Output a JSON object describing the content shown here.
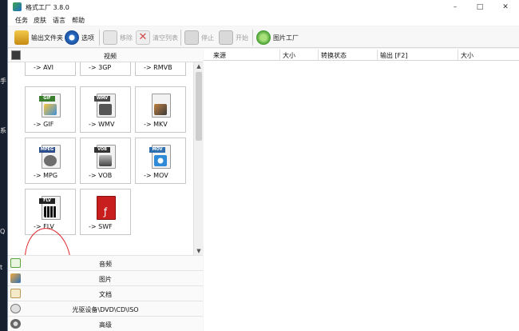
{
  "desktop": {
    "glyphs": [
      "手",
      "系",
      "Q",
      "t"
    ]
  },
  "window": {
    "title": "格式工厂 3.8.0",
    "menu": [
      "任务",
      "皮肤",
      "语言",
      "帮助"
    ],
    "controls": {
      "minimize": "–",
      "maximize": "□",
      "close": "✕"
    }
  },
  "toolbar": {
    "output_folder": "输出文件夹",
    "options": "选项",
    "remove": "移除",
    "clear_list": "清空列表",
    "stop": "停止",
    "start": "开始",
    "picture_factory": "图片工厂"
  },
  "left_panel": {
    "video_header": "视频",
    "formats": [
      {
        "label": "-> AVI",
        "tag": "",
        "color": "#7a9ac8"
      },
      {
        "label": "-> 3GP",
        "tag": "",
        "color": "#4da44d"
      },
      {
        "label": "-> RMVB",
        "tag": "",
        "color": "#8a8a8a"
      },
      {
        "label": "-> GIF",
        "tag": "GIF",
        "color": "#3b7d2e"
      },
      {
        "label": "-> WMV",
        "tag": "WMV",
        "color": "#4a4a4a"
      },
      {
        "label": "-> MKV",
        "tag": "",
        "color": "#c08040"
      },
      {
        "label": "-> MPG",
        "tag": "MPEG",
        "color": "#2d4e8a"
      },
      {
        "label": "-> VOB",
        "tag": "VOB",
        "color": "#333333"
      },
      {
        "label": "-> MOV",
        "tag": "MOV",
        "color": "#2f6fb0"
      },
      {
        "label": "-> FLV",
        "tag": "FLV",
        "color": "#222222"
      },
      {
        "label": "-> SWF",
        "tag": "SWF",
        "color": "#c81e1e"
      }
    ],
    "categories": [
      "音频",
      "图片",
      "文档",
      "光驱设备\\DVD\\CD\\ISO",
      "高级"
    ]
  },
  "table": {
    "columns": [
      "来源",
      "大小",
      "转换状态",
      "输出 [F2]",
      "大小"
    ]
  }
}
